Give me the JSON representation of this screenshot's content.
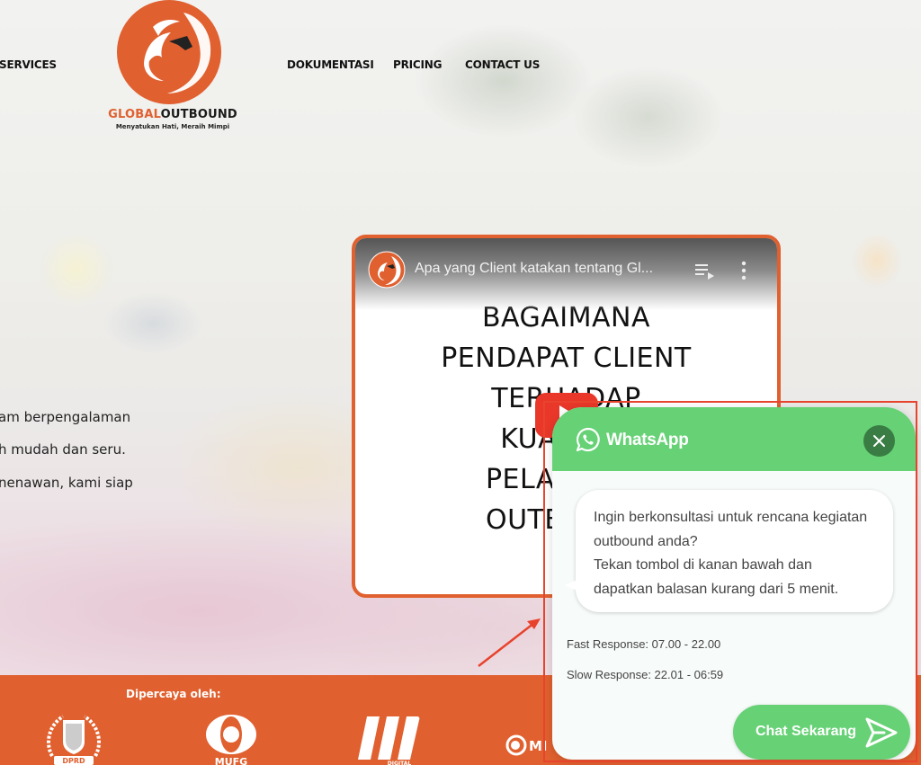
{
  "nav": {
    "items": [
      {
        "label": "SERVICES"
      },
      {
        "label": "DOKUMENTASI"
      },
      {
        "label": "PRICING"
      },
      {
        "label": "CONTACT US"
      }
    ]
  },
  "logo": {
    "brand_part1": "GLOBAL",
    "brand_part2": "OUTBOUND",
    "tagline": "Menyatukan Hati, Meraih Mimpi",
    "color": "#e0602f"
  },
  "hero": {
    "lines": [
      "am berpengalaman",
      "h mudah dan seru.",
      "nenawan, kami siap"
    ]
  },
  "video": {
    "title": "Apa yang Client katakan tentang Gl...",
    "overlay_lines": [
      "BAGAIMANA",
      "PENDAPAT CLIENT",
      "TERHADAP",
      "KUALITAS",
      "PELAYANAN",
      "OUTBOUND"
    ],
    "border_color": "#e0602f",
    "queue_icon": "playlist-icon",
    "more_icon": "more-vert-icon"
  },
  "trusted": {
    "label": "Dipercaya oleh:",
    "partners": [
      {
        "name": "DPRD"
      },
      {
        "name": "MUFG"
      },
      {
        "name": "DIGITAL"
      },
      {
        "name": "MI"
      }
    ],
    "color": "#e0602f"
  },
  "whatsapp": {
    "title": "WhatsApp",
    "message_line1": "Ingin berkonsultasi untuk rencana kegiatan outbound anda?",
    "message_line2": "Tekan tombol di kanan bawah dan dapatkan balasan kurang dari 5 menit.",
    "fast_response": "Fast Response: 07.00 - 22.00",
    "slow_response": "Slow Response: 22.01 - 06:59",
    "cta_label": "Chat Sekarang",
    "accent_color": "#66d175",
    "close_color": "#3a7d44"
  },
  "annotation": {
    "color": "#e8432c"
  }
}
